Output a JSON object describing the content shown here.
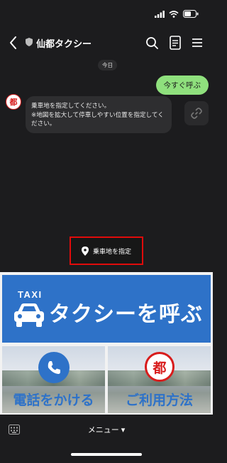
{
  "header": {
    "title": "仙都タクシー"
  },
  "chat": {
    "date_label": "今日",
    "outgoing_message": "今すぐ呼ぶ",
    "incoming_message_line1": "乗車地を指定してください。",
    "incoming_message_line2": "※地図を拡大して停車しやすい位置を指定してください。",
    "avatar_text": "都",
    "pickup_button_label": "乗車地を指定"
  },
  "rich_menu": {
    "taxi_word": "TAXI",
    "call_taxi_label": "タクシーを呼ぶ",
    "phone_label": "電話をかける",
    "usage_label": "ご利用方法",
    "seal_text": "都",
    "accent_color": "#2e72c8"
  },
  "bottom_bar": {
    "menu_toggle_label": "メニュー ▾"
  }
}
